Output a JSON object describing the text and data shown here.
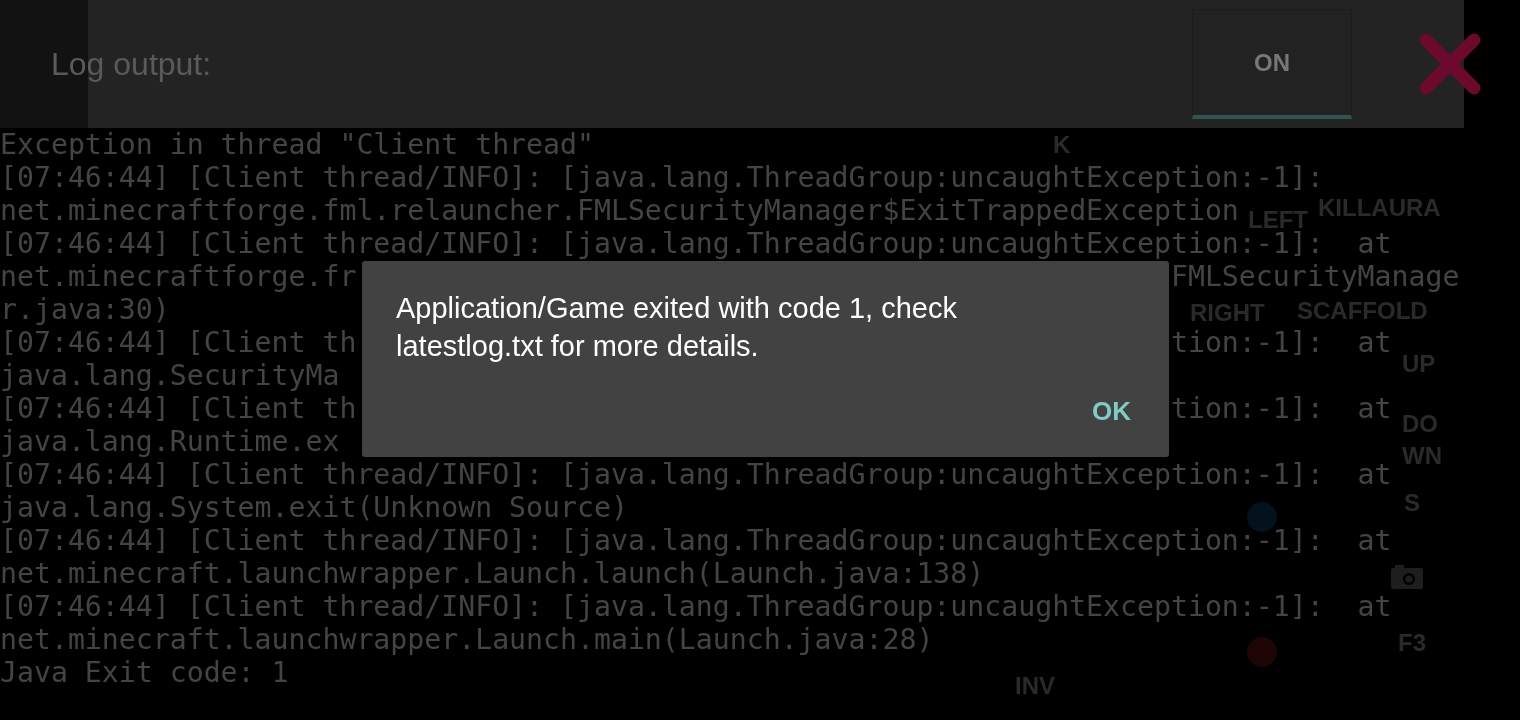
{
  "header": {
    "title": "Log output:",
    "toggle": {
      "label": "ON",
      "on": true
    }
  },
  "log": {
    "lines": [
      {
        "text": "Exception in thread \"Client thread\""
      },
      {
        "text": "[07:46:44] [Client thread/INFO]: [java.lang.ThreadGroup:uncaughtException:-1]:"
      },
      {
        "text": "net.minecraftforge.fml.relauncher.FMLSecurityManager$ExitTrappedException"
      },
      {
        "text": "[07:46:44] [Client thread/INFO]: [java.lang.ThreadGroup:uncaughtException:-1]:  at"
      },
      {
        "text": "net.minecraftforge.fr",
        "text_right": "FMLSecurityManage"
      },
      {
        "text": "r.java:30)"
      },
      {
        "text": "[07:46:44] [Client th",
        "text_right": "tion:-1]:  at"
      },
      {
        "text": "java.lang.SecurityMa"
      },
      {
        "text": "[07:46:44] [Client th",
        "text_right": "tion:-1]:  at"
      },
      {
        "text": "java.lang.Runtime.ex"
      },
      {
        "text": "[07:46:44] [Client thread/INFO]: [java.lang.ThreadGroup:uncaughtException:-1]:  at"
      },
      {
        "text": "java.lang.System.exit(Unknown Source)"
      },
      {
        "text": "[07:46:44] [Client thread/INFO]: [java.lang.ThreadGroup:uncaughtException:-1]:  at"
      },
      {
        "text": "net.minecraft.launchwrapper.Launch.launch(Launch.java:138)"
      },
      {
        "text": "[07:46:44] [Client thread/INFO]: [java.lang.ThreadGroup:uncaughtException:-1]:  at"
      },
      {
        "text": "net.minecraft.launchwrapper.Launch.main(Launch.java:28)"
      },
      {
        "text": "Java Exit code: 1"
      }
    ]
  },
  "overlay_controls": [
    {
      "label": "K"
    },
    {
      "label": "KILLAURA"
    },
    {
      "label": "LEFT"
    },
    {
      "label": "SCAFFOLD"
    },
    {
      "label": "RIGHT"
    },
    {
      "label": "UP"
    },
    {
      "label": "DOWN"
    },
    {
      "label": "S"
    },
    {
      "label": "F3"
    },
    {
      "label": "INV"
    }
  ],
  "dialog": {
    "message": "Application/Game exited with code 1, check latestlog.txt for more details.",
    "buttons": [
      "OK"
    ]
  }
}
